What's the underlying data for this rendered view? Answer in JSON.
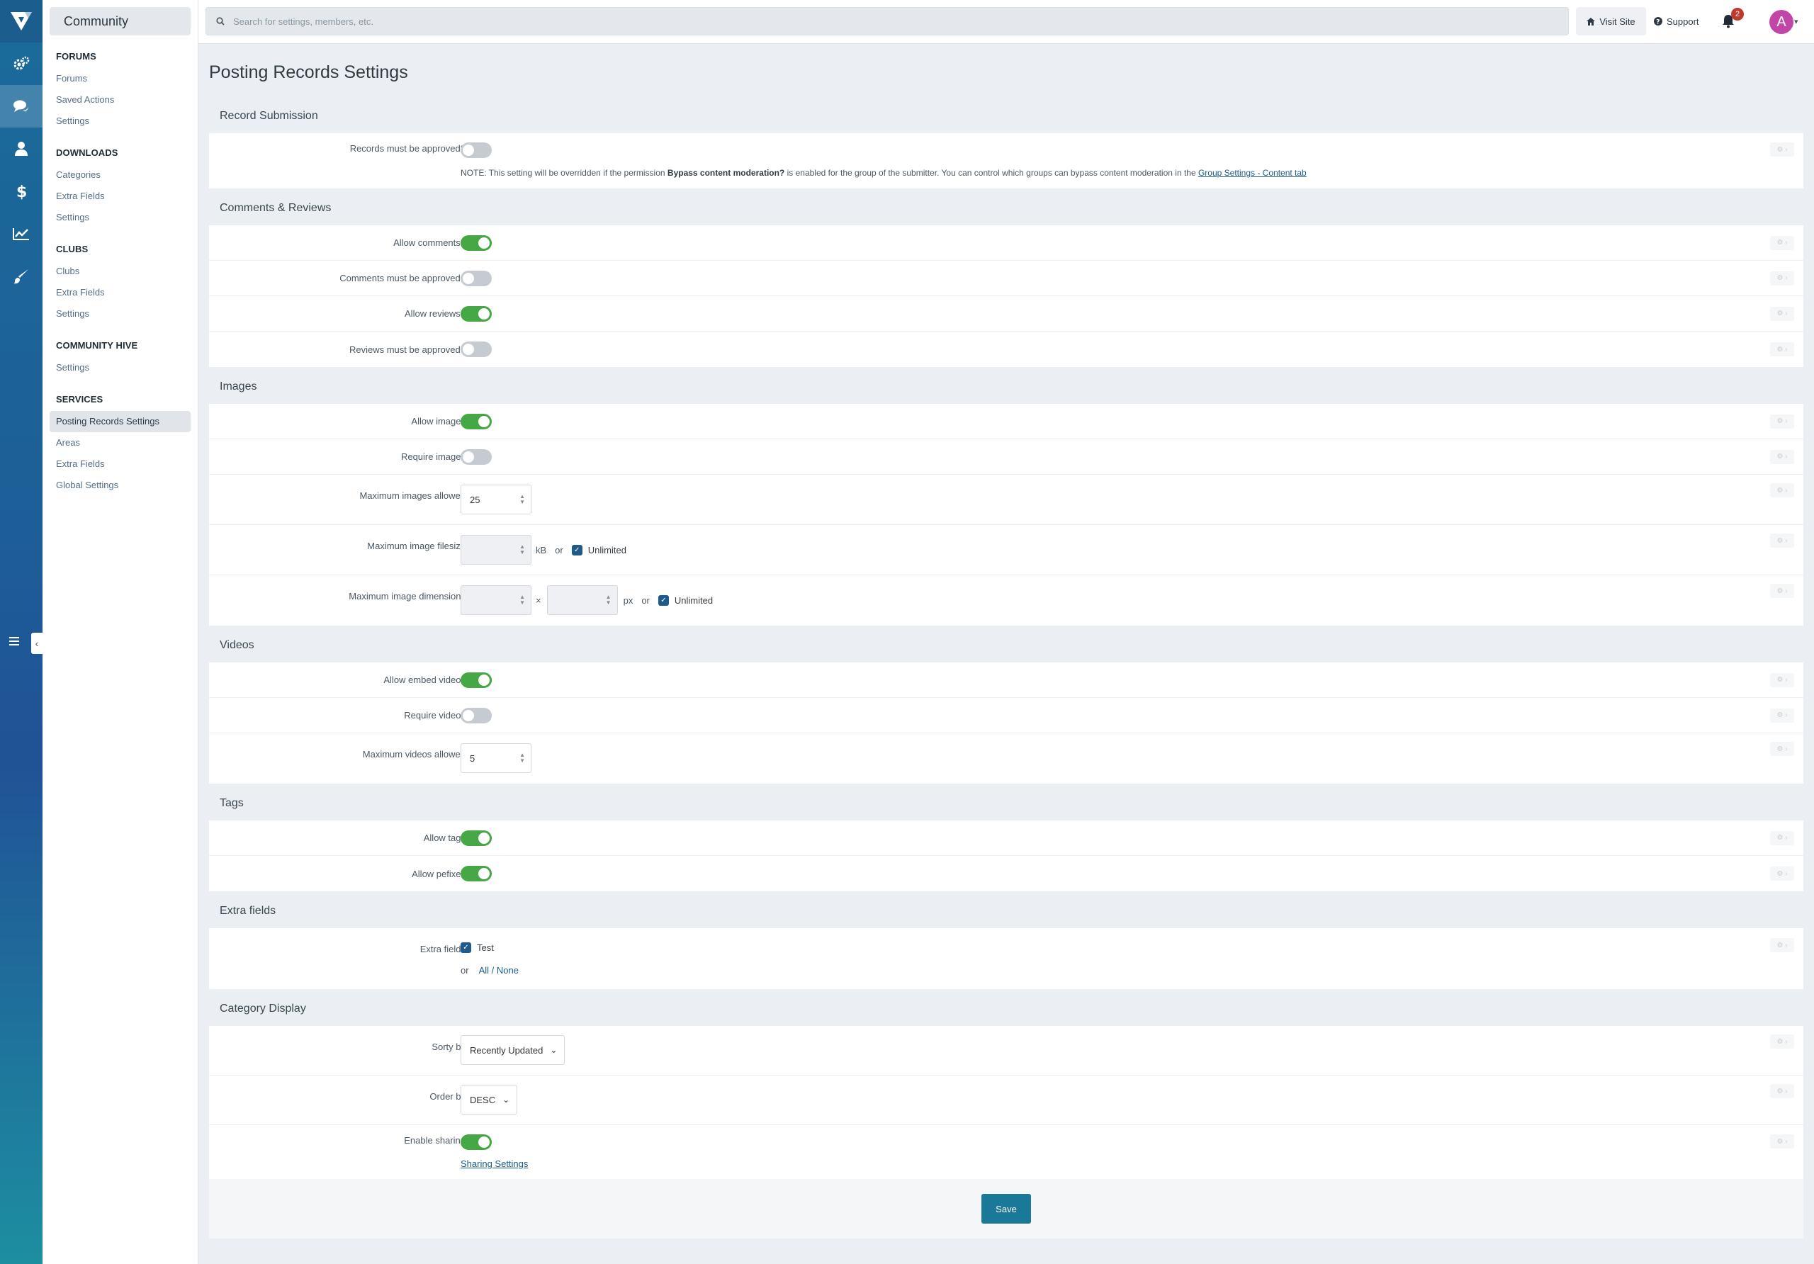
{
  "nav": {
    "app_name": "Community",
    "sections": [
      {
        "title": "FORUMS",
        "items": [
          "Forums",
          "Saved Actions",
          "Settings"
        ]
      },
      {
        "title": "DOWNLOADS",
        "items": [
          "Categories",
          "Extra Fields",
          "Settings"
        ]
      },
      {
        "title": "CLUBS",
        "items": [
          "Clubs",
          "Extra Fields",
          "Settings"
        ]
      },
      {
        "title": "COMMUNITY HIVE",
        "items": [
          "Settings"
        ]
      },
      {
        "title": "SERVICES",
        "items": [
          "Posting Records Settings",
          "Areas",
          "Extra Fields",
          "Global Settings"
        ]
      }
    ],
    "active_item": "Posting Records Settings"
  },
  "topbar": {
    "search_placeholder": "Search for settings, members, etc.",
    "visit_site": "Visit Site",
    "support": "Support",
    "notification_count": "2",
    "avatar_letter": "A"
  },
  "page": {
    "title": "Posting Records Settings"
  },
  "groups": {
    "record_submission": {
      "title": "Record Submission",
      "records_approved_label": "Records must be approved?",
      "note_prefix": "NOTE: This setting will be overridden if the permission ",
      "note_bold": "Bypass content moderation?",
      "note_mid": " is enabled for the group of the submitter. You can control which groups can bypass content moderation in the ",
      "note_link": "Group Settings - Content tab"
    },
    "comments": {
      "title": "Comments & Reviews",
      "allow_comments": "Allow comments?",
      "comments_approved": "Comments must be approved?",
      "allow_reviews": "Allow reviews?",
      "reviews_approved": "Reviews must be approved?"
    },
    "images": {
      "title": "Images",
      "allow_images": "Allow images",
      "require_images": "Require images",
      "max_images_label": "Maximum images allowed",
      "max_images_value": "25",
      "max_filesize_label": "Maximum image filesize",
      "filesize_unit": "kB",
      "or": "or",
      "unlimited": "Unlimited",
      "max_dimensions_label": "Maximum image dimensions",
      "times": "×",
      "px": "px"
    },
    "videos": {
      "title": "Videos",
      "allow_embed": "Allow embed videos",
      "require_videos": "Require videos",
      "max_videos_label": "Maximum videos allowed",
      "max_videos_value": "5"
    },
    "tags": {
      "title": "Tags",
      "allow_tags": "Allow tags",
      "allow_prefixes": "Allow pefixes"
    },
    "extra_fields": {
      "title": "Extra fields",
      "label": "Extra fields",
      "option_test": "Test",
      "or": "or",
      "all_none": "All / None"
    },
    "category_display": {
      "title": "Category Display",
      "sort_by_label": "Sorty by",
      "sort_by_value": "Recently Updated",
      "order_by_label": "Order by",
      "order_by_value": "DESC",
      "enable_sharing_label": "Enable sharing",
      "sharing_settings_link": "Sharing Settings"
    }
  },
  "actions": {
    "save": "Save"
  },
  "colors": {
    "toggle_on": "#45a745",
    "toggle_off": "#c6cbd1",
    "primary_button": "#1a7898",
    "link": "#1a5c8a"
  }
}
